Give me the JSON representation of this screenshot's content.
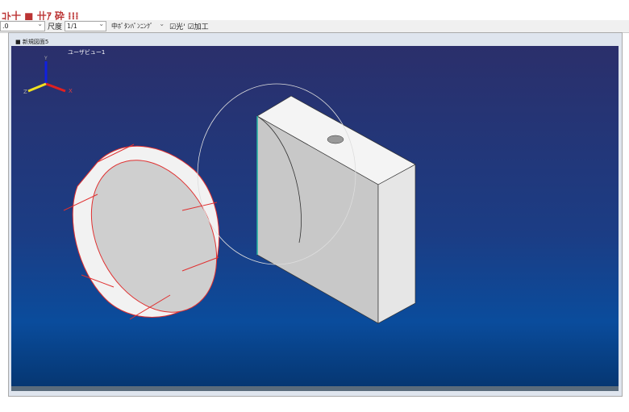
{
  "toolbar": {
    "icons": "ｺﾄ十 ■ 卄ｱ 砕 ⁞⁞⁞",
    "layer_value": ".0",
    "scale_label": "尺度",
    "scale_value": "1/1",
    "mode_value": "中ﾎﾞﾀﾝﾊﾟﾝﾆﾝｸﾞ",
    "check1": "光'",
    "check2": "加工"
  },
  "window": {
    "title": "新規図面5",
    "view_label": "ユーザビュー1"
  },
  "axes": {
    "x": "X",
    "y": "Y",
    "z": "Z"
  }
}
